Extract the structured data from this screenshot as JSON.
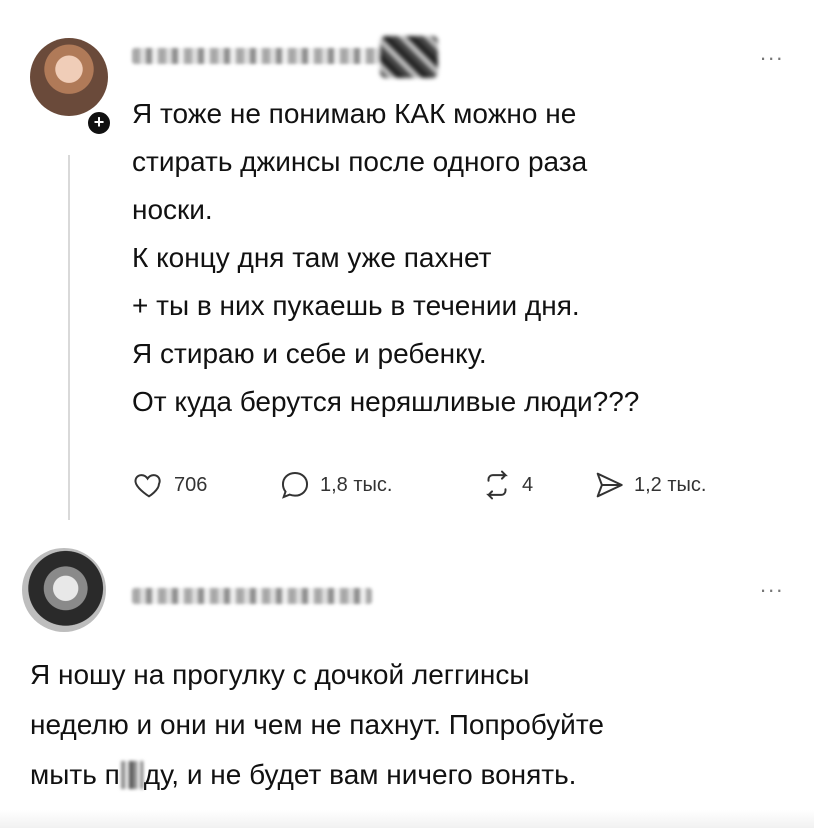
{
  "post": {
    "text_lines": [
      "Я тоже не понимаю КАК можно не",
      "стирать джинсы после одного раза",
      "носки.",
      "К концу дня там уже пахнет",
      "+ ты в них пукаешь в течении дня.",
      "Я стираю и себе и ребенку.",
      "От куда берутся неряшливые люди???"
    ],
    "plus_badge": "+",
    "more": "...",
    "actions": {
      "likes": "706",
      "comments": "1,8 тыс.",
      "reposts": "4",
      "shares": "1,2 тыс."
    }
  },
  "reply": {
    "text_before": "Я ношу на прогулку с дочкой леггинсы",
    "text_middle": "неделю и они ни чем не пахнут. Попробуйте",
    "text_end_a": "мыть п",
    "text_end_b": "ду, и не будет вам ничего вонять.",
    "more": "..."
  }
}
